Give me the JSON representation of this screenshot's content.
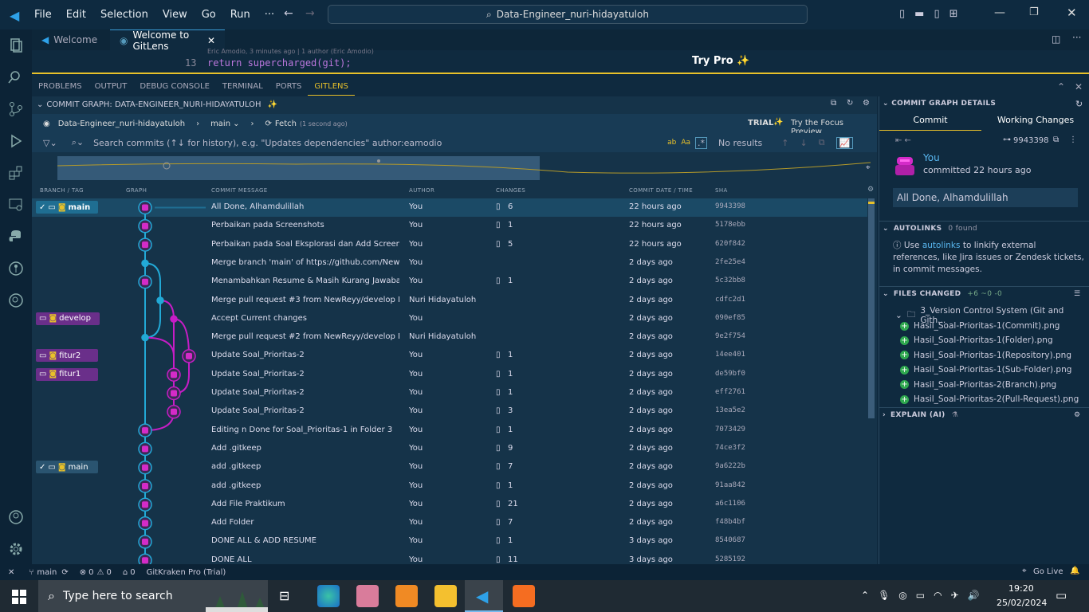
{
  "titlebar": {
    "menu": [
      "File",
      "Edit",
      "Selection",
      "View",
      "Go",
      "Run",
      "···"
    ],
    "search": "Data-Engineer_nuri-hidayatuloh"
  },
  "tabs": [
    {
      "label": "Welcome",
      "active": false
    },
    {
      "label": "Welcome to GitLens",
      "active": true
    }
  ],
  "editor": {
    "blame": "Eric Amodio, 3 minutes ago | 1 author (Eric Amodio)",
    "line_no": "13",
    "code": "return supercharged(git);",
    "try_pro": "Try Pro"
  },
  "panel_tabs": [
    "PROBLEMS",
    "OUTPUT",
    "DEBUG CONSOLE",
    "TERMINAL",
    "PORTS",
    "GITLENS"
  ],
  "graph": {
    "header": "COMMIT GRAPH: DATA-ENGINEER_NURI-HIDAYATULOH",
    "repo": "Data-Engineer_nuri-hidayatuloh",
    "branch": "main",
    "fetch": "Fetch",
    "fetch_time": "(1 second ago)",
    "trial": "TRIAL",
    "focus": "Try the Focus Preview",
    "search_placeholder": "Search commits (↑↓ for history), e.g. \"Updates dependencies\" author:eamodio",
    "no_results": "No results",
    "columns": [
      "BRANCH / TAG",
      "GRAPH",
      "COMMIT MESSAGE",
      "AUTHOR",
      "CHANGES",
      "COMMIT DATE / TIME",
      "SHA"
    ],
    "rows": [
      {
        "msg": "All Done, Alhamdulillah",
        "author": "You",
        "changes": "6",
        "date": "22 hours ago",
        "sha": "9943398"
      },
      {
        "msg": "Perbaikan pada Screenshots",
        "author": "You",
        "changes": "1",
        "date": "22 hours ago",
        "sha": "5178ebb"
      },
      {
        "msg": "Perbaikan pada Soal Eksplorasi dan Add Screenshots",
        "author": "You",
        "changes": "5",
        "date": "22 hours ago",
        "sha": "620f842"
      },
      {
        "msg": "Merge branch 'main' of https://github.com/NewRey...",
        "author": "You",
        "changes": "",
        "date": "2 days ago",
        "sha": "2fe25e4"
      },
      {
        "msg": "Menambahkan Resume & Masih Kurang Jawaban d...",
        "author": "You",
        "changes": "1",
        "date": "2 days ago",
        "sha": "5c32bb8"
      },
      {
        "msg": "Merge pull request #3 from NewReyy/develop  Mer...",
        "author": "Nuri Hidayatuloh",
        "changes": "",
        "date": "2 days ago",
        "sha": "cdfc2d1"
      },
      {
        "msg": "Accept Current changes",
        "author": "You",
        "changes": "",
        "date": "2 days ago",
        "sha": "090ef85"
      },
      {
        "msg": "Merge pull request #2 from NewReyy/develop  Mer...",
        "author": "Nuri Hidayatuloh",
        "changes": "",
        "date": "2 days ago",
        "sha": "9e2f754"
      },
      {
        "msg": "Update Soal_Prioritas-2",
        "author": "You",
        "changes": "1",
        "date": "2 days ago",
        "sha": "14ee401"
      },
      {
        "msg": "Update Soal_Prioritas-2",
        "author": "You",
        "changes": "1",
        "date": "2 days ago",
        "sha": "de59bf0"
      },
      {
        "msg": "Update Soal_Prioritas-2",
        "author": "You",
        "changes": "1",
        "date": "2 days ago",
        "sha": "eff2761"
      },
      {
        "msg": "Update Soal_Prioritas-2",
        "author": "You",
        "changes": "3",
        "date": "2 days ago",
        "sha": "13ea5e2"
      },
      {
        "msg": "Editing n Done for Soal_Prioritas-1 in Folder 3",
        "author": "You",
        "changes": "1",
        "date": "2 days ago",
        "sha": "7073429"
      },
      {
        "msg": "Add .gitkeep",
        "author": "You",
        "changes": "9",
        "date": "2 days ago",
        "sha": "74ce3f2"
      },
      {
        "msg": "add .gitkeep",
        "author": "You",
        "changes": "7",
        "date": "2 days ago",
        "sha": "9a6222b"
      },
      {
        "msg": "add .gitkeep",
        "author": "You",
        "changes": "1",
        "date": "2 days ago",
        "sha": "91aa842"
      },
      {
        "msg": "Add File Praktikum",
        "author": "You",
        "changes": "21",
        "date": "2 days ago",
        "sha": "a6c1106"
      },
      {
        "msg": "Add Folder",
        "author": "You",
        "changes": "7",
        "date": "2 days ago",
        "sha": "f48b4bf"
      },
      {
        "msg": "DONE ALL & ADD RESUME",
        "author": "You",
        "changes": "1",
        "date": "3 days ago",
        "sha": "8540687"
      },
      {
        "msg": "DONE ALL",
        "author": "You",
        "changes": "11",
        "date": "3 days ago",
        "sha": "5285192"
      }
    ],
    "branches": [
      {
        "label": "main",
        "row": 0,
        "color": "#1f6e92"
      },
      {
        "label": "develop",
        "row": 6,
        "color": "#6a2f8a"
      },
      {
        "label": "fitur2",
        "row": 8,
        "color": "#6a2f8a"
      },
      {
        "label": "fitur1",
        "row": 9,
        "color": "#6a2f8a"
      },
      {
        "label": "main",
        "row": 14,
        "color": "#2a5470"
      }
    ]
  },
  "details": {
    "header": "COMMIT GRAPH DETAILS",
    "tab_commit": "Commit",
    "tab_wc": "Working Changes",
    "sha": "9943398",
    "author": "You",
    "committed": "committed 22 hours ago",
    "message": "All Done, Alhamdulillah",
    "autolinks_title": "AUTOLINKS",
    "autolinks_count": "0 found",
    "autolinks_use": "Use",
    "autolinks_link": "autolinks",
    "autolinks_text": "to linkify external references, like Jira issues or Zendesk tickets, in commit messages.",
    "files_title": "FILES CHANGED",
    "files_stats": "+6  ~0  -0",
    "folder": "3_Version Control System (Git and Gith...",
    "files": [
      "Hasil_Soal-Prioritas-1(Commit).png",
      "Hasil_Soal-Prioritas-1(Folder).png",
      "Hasil_Soal-Prioritas-1(Repository).png",
      "Hasil_Soal-Prioritas-1(Sub-Folder).png",
      "Hasil_Soal-Prioritas-2(Branch).png",
      "Hasil_Soal-Prioritas-2(Pull-Request).png"
    ],
    "explain": "EXPLAIN (AI)"
  },
  "statusbar": {
    "branch": "main",
    "errors": "0",
    "warnings": "0",
    "ports": "0",
    "gitkraken": "GitKraken Pro (Trial)",
    "golive": "Go Live"
  },
  "taskbar": {
    "search": "Type here to search",
    "time": "19:20",
    "date": "25/02/2024"
  },
  "colors": {
    "accent": "#e8c12a",
    "main_line": "#22a9d6",
    "merge_line": "#c61dc6"
  }
}
